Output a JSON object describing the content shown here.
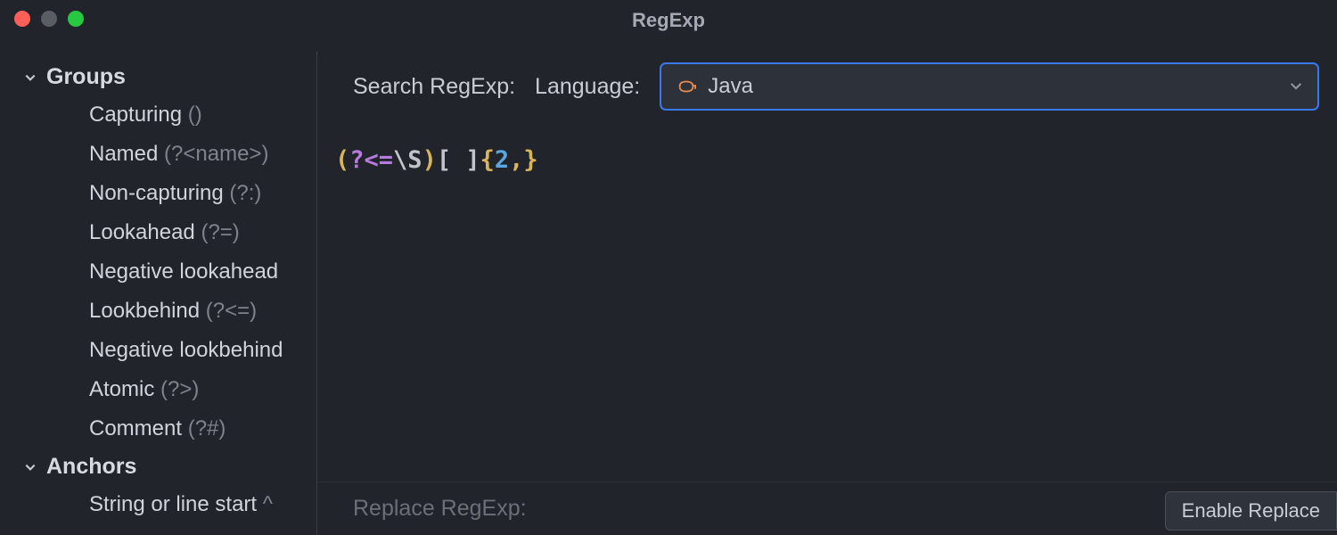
{
  "window": {
    "title": "RegExp"
  },
  "sidebar": {
    "groups": {
      "header": "Groups",
      "items": [
        {
          "label": "Capturing",
          "hint": "()"
        },
        {
          "label": "Named",
          "hint": "(?<name>)"
        },
        {
          "label": "Non-capturing",
          "hint": "(?:)"
        },
        {
          "label": "Lookahead",
          "hint": "(?=)"
        },
        {
          "label": "Negative lookahead",
          "hint": ""
        },
        {
          "label": "Lookbehind",
          "hint": "(?<=)"
        },
        {
          "label": "Negative lookbehind",
          "hint": ""
        },
        {
          "label": "Atomic",
          "hint": "(?>)"
        },
        {
          "label": "Comment",
          "hint": "(?#)"
        }
      ]
    },
    "anchors": {
      "header": "Anchors",
      "items": [
        {
          "label": "String or line start",
          "hint": "^"
        }
      ]
    }
  },
  "search": {
    "searchLabel": "Search RegExp:",
    "languageLabel": "Language:",
    "languageValue": "Java"
  },
  "regex": {
    "tokens": [
      {
        "text": "(",
        "class": "t-yellow"
      },
      {
        "text": "?<=",
        "class": "t-purple"
      },
      {
        "text": "\\S",
        "class": "t-gray"
      },
      {
        "text": ")",
        "class": "t-yellow"
      },
      {
        "text": "[ ]",
        "class": "t-gray"
      },
      {
        "text": "{",
        "class": "t-orange"
      },
      {
        "text": "2",
        "class": "t-blue"
      },
      {
        "text": ",",
        "class": "t-orange"
      },
      {
        "text": "}",
        "class": "t-orange"
      }
    ]
  },
  "replace": {
    "label": "Replace RegExp:",
    "enableButton": "Enable Replace"
  }
}
